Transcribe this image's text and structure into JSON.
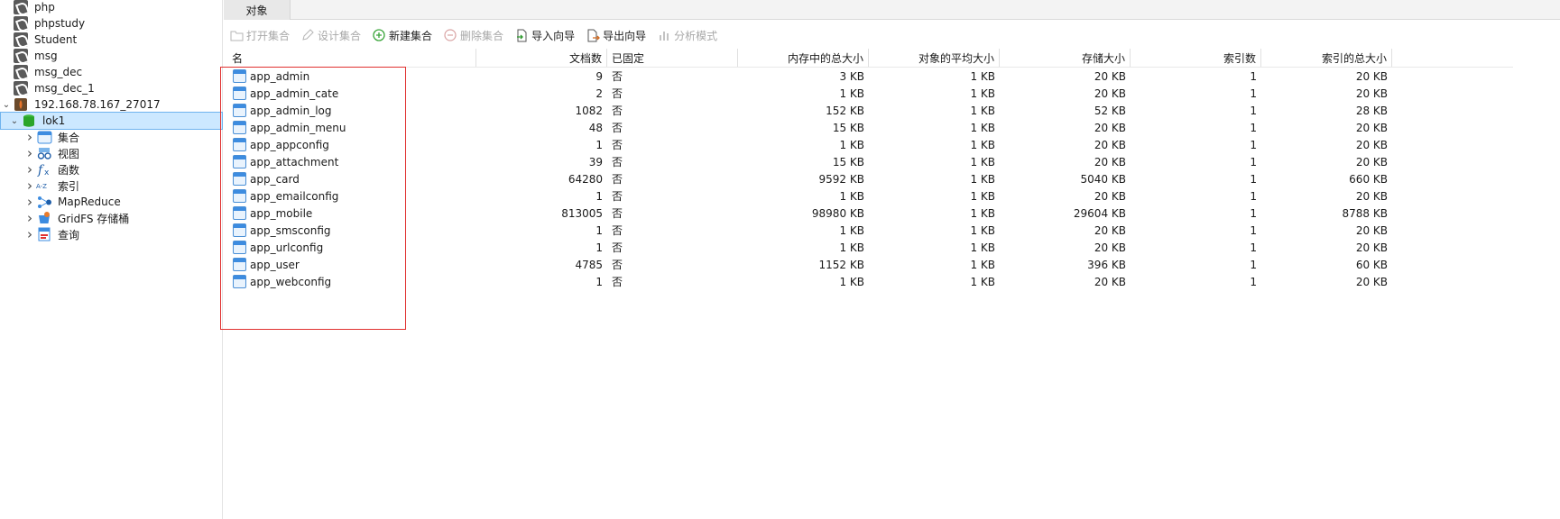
{
  "sidebar": {
    "items": [
      {
        "label": "php",
        "icon": "mongodb-db-icon",
        "arrow": ""
      },
      {
        "label": "phpstudy",
        "icon": "mongodb-db-icon",
        "arrow": ""
      },
      {
        "label": "Student",
        "icon": "mongodb-db-icon",
        "arrow": ""
      },
      {
        "label": "msg",
        "icon": "mongodb-db-icon",
        "arrow": ""
      },
      {
        "label": "msg_dec",
        "icon": "mongodb-db-icon",
        "arrow": ""
      },
      {
        "label": "msg_dec_1",
        "icon": "mongodb-db-icon",
        "arrow": ""
      },
      {
        "label": "192.168.78.167_27017",
        "icon": "connection-icon",
        "arrow": "⌄"
      },
      {
        "label": "lok1",
        "icon": "database-icon",
        "arrow": "⌄"
      },
      {
        "label": "集合",
        "icon": "collections-icon",
        "arrow": "›"
      },
      {
        "label": "视图",
        "icon": "views-icon",
        "arrow": "›"
      },
      {
        "label": "函数",
        "icon": "function-icon",
        "arrow": "›"
      },
      {
        "label": "索引",
        "icon": "index-icon",
        "arrow": "›"
      },
      {
        "label": "MapReduce",
        "icon": "mapreduce-icon",
        "arrow": "›"
      },
      {
        "label": "GridFS 存储桶",
        "icon": "gridfs-icon",
        "arrow": "›"
      },
      {
        "label": "查询",
        "icon": "query-icon",
        "arrow": "›"
      }
    ]
  },
  "tab": {
    "label": "对象"
  },
  "toolbar": {
    "open": "打开集合",
    "design": "设计集合",
    "new": "新建集合",
    "delete": "删除集合",
    "import": "导入向导",
    "export": "导出向导",
    "analyze": "分析模式"
  },
  "columns": [
    "名",
    "文档数",
    "已固定",
    "内存中的总大小",
    "对象的平均大小",
    "存储大小",
    "索引数",
    "索引的总大小"
  ],
  "rows": [
    {
      "name": "app_admin",
      "docs": "9",
      "capped": "否",
      "mem": "3 KB",
      "avg": "1 KB",
      "storage": "20 KB",
      "idx": "1",
      "idxsize": "20 KB"
    },
    {
      "name": "app_admin_cate",
      "docs": "2",
      "capped": "否",
      "mem": "1 KB",
      "avg": "1 KB",
      "storage": "20 KB",
      "idx": "1",
      "idxsize": "20 KB"
    },
    {
      "name": "app_admin_log",
      "docs": "1082",
      "capped": "否",
      "mem": "152 KB",
      "avg": "1 KB",
      "storage": "52 KB",
      "idx": "1",
      "idxsize": "28 KB"
    },
    {
      "name": "app_admin_menu",
      "docs": "48",
      "capped": "否",
      "mem": "15 KB",
      "avg": "1 KB",
      "storage": "20 KB",
      "idx": "1",
      "idxsize": "20 KB"
    },
    {
      "name": "app_appconfig",
      "docs": "1",
      "capped": "否",
      "mem": "1 KB",
      "avg": "1 KB",
      "storage": "20 KB",
      "idx": "1",
      "idxsize": "20 KB"
    },
    {
      "name": "app_attachment",
      "docs": "39",
      "capped": "否",
      "mem": "15 KB",
      "avg": "1 KB",
      "storage": "20 KB",
      "idx": "1",
      "idxsize": "20 KB"
    },
    {
      "name": "app_card",
      "docs": "64280",
      "capped": "否",
      "mem": "9592 KB",
      "avg": "1 KB",
      "storage": "5040 KB",
      "idx": "1",
      "idxsize": "660 KB"
    },
    {
      "name": "app_emailconfig",
      "docs": "1",
      "capped": "否",
      "mem": "1 KB",
      "avg": "1 KB",
      "storage": "20 KB",
      "idx": "1",
      "idxsize": "20 KB"
    },
    {
      "name": "app_mobile",
      "docs": "813005",
      "capped": "否",
      "mem": "98980 KB",
      "avg": "1 KB",
      "storage": "29604 KB",
      "idx": "1",
      "idxsize": "8788 KB"
    },
    {
      "name": "app_smsconfig",
      "docs": "1",
      "capped": "否",
      "mem": "1 KB",
      "avg": "1 KB",
      "storage": "20 KB",
      "idx": "1",
      "idxsize": "20 KB"
    },
    {
      "name": "app_urlconfig",
      "docs": "1",
      "capped": "否",
      "mem": "1 KB",
      "avg": "1 KB",
      "storage": "20 KB",
      "idx": "1",
      "idxsize": "20 KB"
    },
    {
      "name": "app_user",
      "docs": "4785",
      "capped": "否",
      "mem": "1152 KB",
      "avg": "1 KB",
      "storage": "396 KB",
      "idx": "1",
      "idxsize": "60 KB"
    },
    {
      "name": "app_webconfig",
      "docs": "1",
      "capped": "否",
      "mem": "1 KB",
      "avg": "1 KB",
      "storage": "20 KB",
      "idx": "1",
      "idxsize": "20 KB"
    }
  ],
  "colors": {
    "selection": "#cce8ff",
    "highlight_box": "#e0302f",
    "collection_icon": "#3d8ce0"
  }
}
